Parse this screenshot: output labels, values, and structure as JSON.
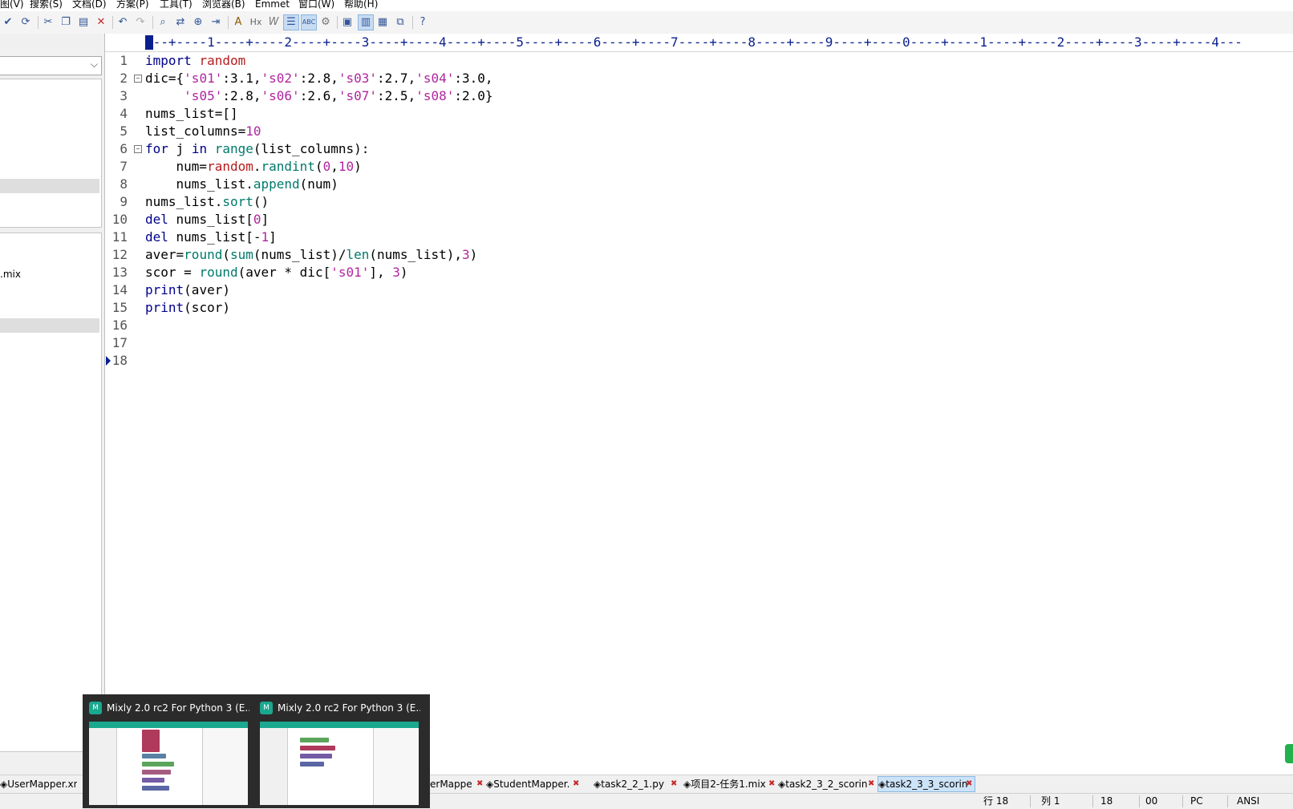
{
  "menu": {
    "items": [
      "图(V)",
      "搜索(S)",
      "文档(D)",
      "方案(P)",
      "工具(T)",
      "浏览器(B)",
      "Emmet",
      "窗口(W)",
      "帮助(H)"
    ]
  },
  "toolbar": {
    "icons": [
      "spellcheck-icon",
      "sync-icon",
      "cut-icon",
      "copy-icon",
      "paste-icon",
      "delete-icon",
      "undo-icon",
      "redo-icon",
      "find-icon",
      "replace-icon",
      "find-in-files-icon",
      "goto-icon",
      "font-icon",
      "hex-icon",
      "word-wrap-icon",
      "indent-guide-icon",
      "abc-icon",
      "settings-icon",
      "view1-icon",
      "view2-icon",
      "view3-icon",
      "view4-icon",
      "help-icon"
    ]
  },
  "left_panel": {
    "file_item": ".mix"
  },
  "ruler": {
    "text": "---+----1----+----2----+----3----+----4----+----5----+----6----+----7----+----8----+----9----+----0----+----1----+----2----+----3----+----4---"
  },
  "editor": {
    "line_numbers": [
      "1",
      "2",
      "3",
      "4",
      "5",
      "6",
      "7",
      "8",
      "9",
      "10",
      "11",
      "12",
      "13",
      "14",
      "15",
      "16",
      "17",
      "18"
    ],
    "current_line": 18
  },
  "taskbar_popup": {
    "windows": [
      {
        "title": "Mixly 2.0 rc2 For Python 3 (E..."
      },
      {
        "title": "Mixly 2.0 rc2 For Python 3 (E..."
      }
    ],
    "logo_text": "M"
  },
  "file_tabs": [
    {
      "label": "UserMapper.xm",
      "active": false
    },
    {
      "label": "erMappe",
      "active": false
    },
    {
      "label": "StudentMapper.",
      "active": false
    },
    {
      "label": "task2_2_1.py",
      "active": false
    },
    {
      "label": "项目2-任务1.mix",
      "active": false
    },
    {
      "label": "task2_3_2_scorin",
      "active": false
    },
    {
      "label": "task2_3_3_scorin",
      "active": true
    }
  ],
  "status": {
    "row": "行 18",
    "col": "列 1",
    "lines": "18",
    "char": "00",
    "eol": "PC",
    "encoding": "ANSI"
  },
  "colors": {
    "keyword": "#00008b",
    "module": "#b71c1c",
    "string": "#b0259f",
    "function": "#00796b",
    "ruler": "#0a1f8f",
    "active_tab": "#cde3f8"
  }
}
